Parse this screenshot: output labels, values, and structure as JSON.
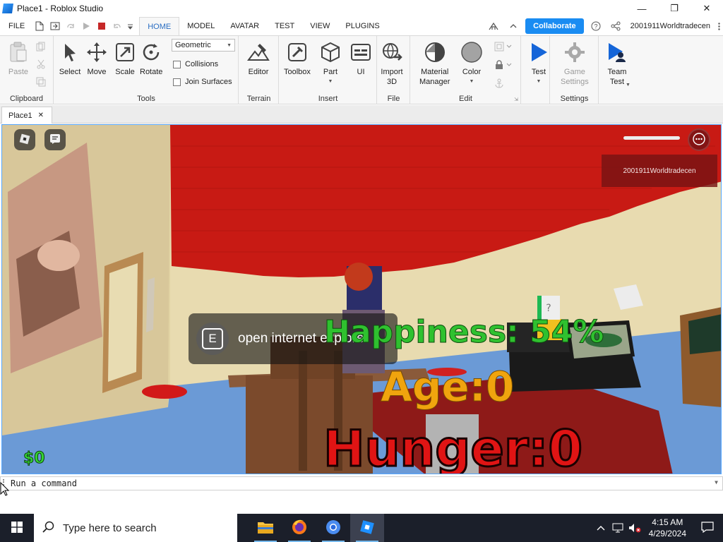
{
  "window": {
    "title": "Place1 - Roblox Studio",
    "controls": {
      "minimize": "—",
      "maximize": "❐",
      "close": "✕"
    }
  },
  "menu": {
    "file": "FILE",
    "tabs": [
      {
        "label": "HOME",
        "active": true
      },
      {
        "label": "MODEL"
      },
      {
        "label": "AVATAR"
      },
      {
        "label": "TEST"
      },
      {
        "label": "VIEW"
      },
      {
        "label": "PLUGINS"
      }
    ],
    "collaborate": "Collaborate",
    "username": "2001911Worldtradecen",
    "accent_color": "#1a8cf2"
  },
  "ribbon": {
    "clipboard": {
      "label": "Clipboard",
      "paste": "Paste"
    },
    "tools": {
      "label": "Tools",
      "select": "Select",
      "move": "Move",
      "scale": "Scale",
      "rotate": "Rotate",
      "mode": "Geometric",
      "collisions": "Collisions",
      "join_surfaces": "Join Surfaces"
    },
    "terrain": {
      "label": "Terrain",
      "editor": "Editor"
    },
    "insert": {
      "label": "Insert",
      "toolbox": "Toolbox",
      "part": "Part",
      "ui": "UI"
    },
    "file": {
      "label": "File",
      "import_3d": "Import\n3D"
    },
    "edit": {
      "label": "Edit",
      "material_manager": "Material\nManager",
      "color": "Color"
    },
    "test": {
      "test": "Test"
    },
    "settings": {
      "label": "Settings",
      "game_settings": "Game\nSettings"
    },
    "team_test": {
      "team_test": "Team\nTest"
    }
  },
  "document_tab": {
    "label": "Place1",
    "close": "✕"
  },
  "viewport": {
    "player_name": "2001911Worldtradecen",
    "interaction_prompt": {
      "key": "E",
      "action": "open internet explorer"
    },
    "hud": {
      "happiness": "Happiness: 54%",
      "age": "Age:0",
      "hunger": "Hunger:0",
      "money": "$0"
    },
    "sign": "?"
  },
  "command_bar": {
    "placeholder": "Run a command"
  },
  "taskbar": {
    "search_placeholder": "Type here to search",
    "apps": [
      "file-explorer",
      "firefox",
      "chrome",
      "roblox-studio"
    ],
    "time": "4:15 AM",
    "date": "4/29/2024"
  }
}
